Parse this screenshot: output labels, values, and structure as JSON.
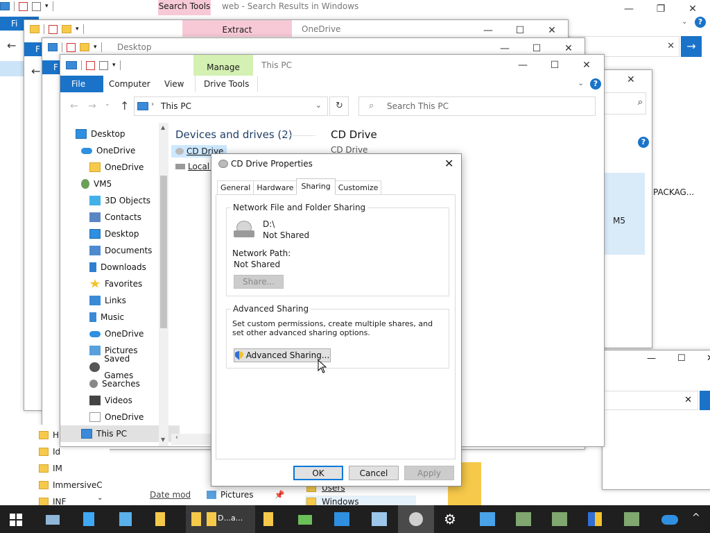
{
  "windows": {
    "back1": {
      "title": "web - Search Results in Windows",
      "context_tab": "Search Tools"
    },
    "back2": {
      "title": "OneDrive",
      "context_tab": "Extract"
    },
    "back3": {
      "title": "Desktop"
    },
    "back_right": {
      "partial_text1": "PACKAG...",
      "partial_text2": "M5"
    },
    "bottom_left": {
      "items": [
        "H",
        "Id",
        "IM",
        "ImmersiveC",
        "INF"
      ]
    },
    "bottom_mid": {
      "text1": "Date mod",
      "pictures": "Pictures",
      "users": "Users",
      "windows": "Windows"
    }
  },
  "explorer": {
    "title": "This PC",
    "context_tab": "Manage",
    "tabs": {
      "file": "File",
      "computer": "Computer",
      "view": "View",
      "drive_tools": "Drive Tools"
    },
    "address": "This PC",
    "search_placeholder": "Search This PC",
    "section_header": "Devices and drives (2)",
    "drives": {
      "cd": "CD Drive",
      "local": "Local D"
    },
    "details": {
      "title": "CD Drive",
      "subtitle": "CD Drive"
    },
    "nav": [
      {
        "label": "Desktop",
        "icon": "desktop-icon"
      },
      {
        "label": "OneDrive",
        "icon": "cloud-icon"
      },
      {
        "label": "OneDrive",
        "icon": "folder-icon"
      },
      {
        "label": "VM5",
        "icon": "user-icon"
      },
      {
        "label": "3D Objects",
        "icon": "cube-icon"
      },
      {
        "label": "Contacts",
        "icon": "contacts-icon"
      },
      {
        "label": "Desktop",
        "icon": "desktop-icon"
      },
      {
        "label": "Documents",
        "icon": "documents-icon"
      },
      {
        "label": "Downloads",
        "icon": "downloads-icon"
      },
      {
        "label": "Favorites",
        "icon": "star-icon"
      },
      {
        "label": "Links",
        "icon": "link-icon"
      },
      {
        "label": "Music",
        "icon": "music-icon"
      },
      {
        "label": "OneDrive",
        "icon": "cloud-icon"
      },
      {
        "label": "Pictures",
        "icon": "pictures-icon"
      },
      {
        "label": "Saved Games",
        "icon": "games-icon"
      },
      {
        "label": "Searches",
        "icon": "search-icon"
      },
      {
        "label": "Videos",
        "icon": "video-icon"
      },
      {
        "label": "OneDrive",
        "icon": "onedrive-z-icon"
      },
      {
        "label": "This PC",
        "icon": "pc-icon"
      }
    ]
  },
  "dialog": {
    "title": "CD Drive Properties",
    "tabs": [
      "General",
      "Hardware",
      "Sharing",
      "Customize"
    ],
    "active_tab": "Sharing",
    "network_group_title": "Network File and Folder Sharing",
    "drive_path": "D:\\",
    "drive_status": "Not Shared",
    "network_path_label": "Network Path:",
    "network_path_value": "Not Shared",
    "share_button": "Share...",
    "advanced_group_title": "Advanced Sharing",
    "advanced_description": "Set custom permissions, create multiple shares, and set other advanced sharing options.",
    "advanced_button": "Advanced Sharing...",
    "ok": "OK",
    "cancel": "Cancel",
    "apply": "Apply"
  },
  "taskbar": {
    "partial_label": "D...a..."
  }
}
